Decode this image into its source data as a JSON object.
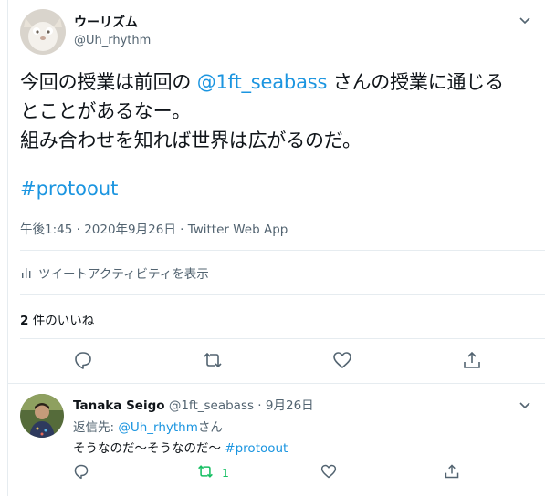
{
  "author": {
    "name": "ウーリズム",
    "handle": "@Uh_rhythm"
  },
  "tweet": {
    "line1_prefix": "今回の授業は前回の ",
    "mention": "@1ft_seabass",
    "line1_suffix": " さんの授業に通じる",
    "line2": "とことがあるなー。",
    "line3": "組み合わせを知れば世界は広がるのだ。",
    "hashtag": "#protoout"
  },
  "meta": {
    "time": "午後1:45",
    "sep1": " · ",
    "date": "2020年9月26日",
    "sep2": " · ",
    "source": "Twitter Web App"
  },
  "activity_label": "ツイートアクティビティを表示",
  "likes": {
    "count": "2",
    "label": " 件のいいね"
  },
  "reply": {
    "name": "Tanaka Seigo",
    "handle": "@1ft_seabass",
    "dot": " · ",
    "date": "9月26日",
    "reply_to_prefix": "返信先: ",
    "reply_to_handle": "@Uh_rhythm",
    "reply_to_suffix": "さん",
    "text": "そうなのだ〜そうなのだ〜 ",
    "hashtag": "#protoout",
    "retweet_count": "1"
  },
  "colors": {
    "link": "#1b95e0",
    "secondary": "#536471",
    "retweet_active": "#17bf63",
    "divider": "#e6ecf0"
  },
  "icons": [
    "chevron-down-icon",
    "bar-chart-icon",
    "reply-icon",
    "retweet-icon",
    "like-icon",
    "share-icon"
  ]
}
